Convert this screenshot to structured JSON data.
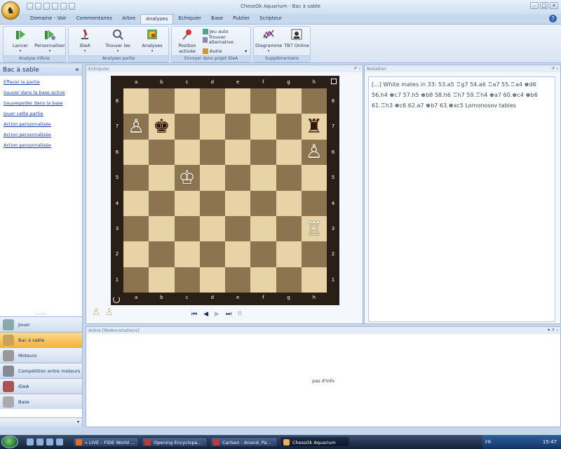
{
  "window": {
    "title": "ChessOk Aquarium - Bac à sable"
  },
  "menu_tabs": [
    {
      "label": "Domaine - Voir"
    },
    {
      "label": "Commentaires"
    },
    {
      "label": "Arbre"
    },
    {
      "label": "Analyses"
    },
    {
      "label": "Echiquier"
    },
    {
      "label": "Base"
    },
    {
      "label": "Publier"
    },
    {
      "label": "Scripteur"
    }
  ],
  "active_tab": "Analyses",
  "ribbon": {
    "groups": [
      {
        "label": "Analyse infinie",
        "buttons": [
          "Lancer",
          "Personnaliser"
        ]
      },
      {
        "label": "Analyses partie",
        "buttons": [
          "IDeA",
          "Trouver les",
          "Analyses"
        ]
      },
      {
        "label": "Envoyer dans projet IDeA",
        "buttons": [
          "Position activée"
        ],
        "options": [
          "Jeu auto",
          "Trouver alternative",
          "Autre"
        ]
      },
      {
        "label": "Supplémentaire",
        "buttons": [
          "Diagramme",
          "TB7 Online"
        ]
      }
    ]
  },
  "left_panel": {
    "title": "Bac à sable",
    "actions": [
      "Effacer la partie",
      "Sauver dans la base active",
      "Sauvegarder dans la base",
      "Jouer cette partie",
      "Action personnalisée",
      "Action personnalisée",
      "Action personnalisée"
    ],
    "nav": [
      {
        "label": "Jouer",
        "active": false
      },
      {
        "label": "Bac à sable",
        "active": true
      },
      {
        "label": "Moteurs",
        "active": false
      },
      {
        "label": "Compétition entre moteurs",
        "active": false
      },
      {
        "label": "IDeA",
        "active": false
      },
      {
        "label": "Base",
        "active": false
      }
    ]
  },
  "board_panel": {
    "title": "Echiquier",
    "files": [
      "a",
      "b",
      "c",
      "d",
      "e",
      "f",
      "g",
      "h"
    ],
    "ranks": [
      "8",
      "7",
      "6",
      "5",
      "4",
      "3",
      "2",
      "1"
    ],
    "pieces": [
      {
        "square": "a7",
        "glyph": "♙",
        "color": "white"
      },
      {
        "square": "b7",
        "glyph": "♚",
        "color": "black"
      },
      {
        "square": "h7",
        "glyph": "♜",
        "color": "black"
      },
      {
        "square": "h6",
        "glyph": "♙",
        "color": "white"
      },
      {
        "square": "c5",
        "glyph": "♔",
        "color": "white"
      },
      {
        "square": "h3",
        "glyph": "♖",
        "color": "white"
      }
    ],
    "captured": [
      "♙",
      "♙"
    ]
  },
  "notation_panel": {
    "title": "Notation",
    "text": "[...] White mates in 33: 53.a5 ♖g7 54.a6 ♖a7 55.♖a4 ♚d6 56.h4 ♚c7 57.h5 ♚b8 58.h6 ♖h7 59.♖h4 ♚a7 60.♚c4 ♚b6 61.♖h3 ♚c6 62.a7 ♚b7 63.♚xc5 Lomonosov tables"
  },
  "tree_panel": {
    "title": "Arbre [NoAnnotations]",
    "message": "pas d'info"
  },
  "taskbar": {
    "tasks": [
      {
        "label": "» LIVE – FIDE World ..."
      },
      {
        "label": "Opening Encyclopa..."
      },
      {
        "label": "Carlsen - Anand, Pa..."
      },
      {
        "label": "ChessOk Aquarium"
      }
    ],
    "lang": "FR",
    "clock": "15:47"
  },
  "colors": {
    "light_square": "#e6d4a6",
    "dark_square": "#8d7451",
    "active_nav": "#f5b33a",
    "ribbon_bg": "#d8e4f3"
  }
}
